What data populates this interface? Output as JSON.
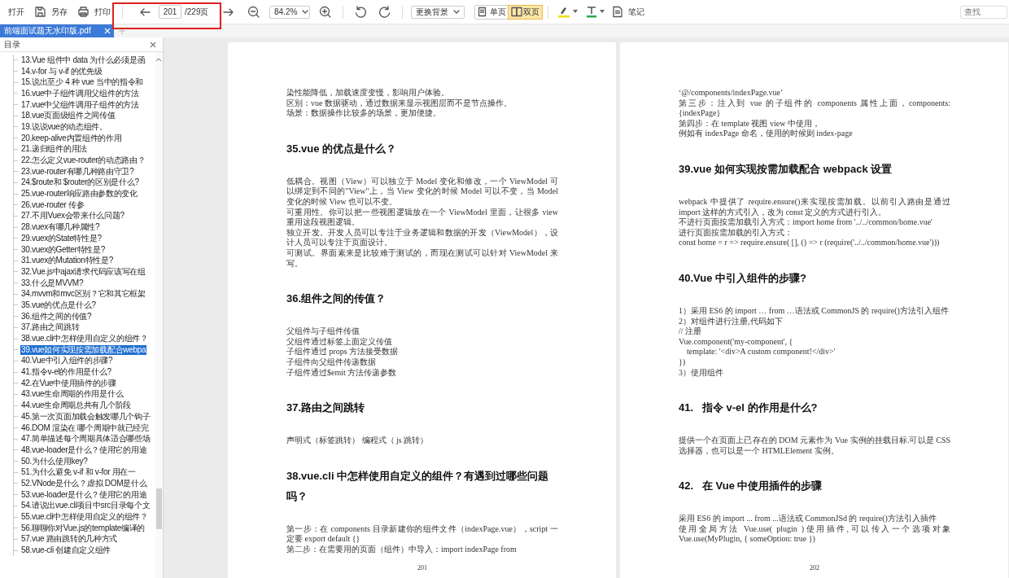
{
  "toolbar": {
    "file_actions": [
      "打开",
      "另存",
      "打印"
    ],
    "page_nav": {
      "current": "201",
      "total": "/229页"
    },
    "zoom": {
      "value": "84.2%"
    },
    "background_menu": {
      "label": "更换背景"
    },
    "view_modes": [
      {
        "label": "单页",
        "selected": false
      },
      {
        "label": "双页",
        "selected": true
      }
    ],
    "notes": {
      "label": "笔记"
    },
    "search": {
      "placeholder": "查找"
    }
  },
  "tabs": [
    {
      "label": "前端面试题无水印版.pdf",
      "selected": true
    }
  ],
  "sidebar": {
    "title": "目录",
    "items": [
      {
        "label": "13.Vue 组件中 data 为什么必须是函",
        "selected": false
      },
      {
        "label": "14.v-for 与 v-if 的优先级",
        "selected": false
      },
      {
        "label": "15.说出至少 4 种 vue 当中的指令和",
        "selected": false
      },
      {
        "label": "16.vue中子组件调用父组件的方法",
        "selected": false
      },
      {
        "label": "17.vue中父组件调用子组件的方法",
        "selected": false
      },
      {
        "label": "18.vue页面级组件之间传值",
        "selected": false
      },
      {
        "label": "19.说说vue的动态组件。",
        "selected": false
      },
      {
        "label": "20.keep-alive内置组件的作用",
        "selected": false
      },
      {
        "label": "21.递归组件的用法",
        "selected": false
      },
      {
        "label": "22.怎么定义vue-router的动态路由？",
        "selected": false
      },
      {
        "label": "23.vue-router有哪几种路由守卫?",
        "selected": false
      },
      {
        "label": "24.$route和 $router的区别是什么?",
        "selected": false
      },
      {
        "label": "25.vue-router响应路由参数的变化",
        "selected": false
      },
      {
        "label": "26.vue-router 传参",
        "selected": false
      },
      {
        "label": "27.不用Vuex会带来什么问题?",
        "selected": false
      },
      {
        "label": "28.vuex有哪几种属性?",
        "selected": false
      },
      {
        "label": "29.vuex的State特性是?",
        "selected": false
      },
      {
        "label": "30.vuex的Getter特性是?",
        "selected": false
      },
      {
        "label": "31.vuex的Mutation特性是?",
        "selected": false
      },
      {
        "label": "32.Vue.js中ajax请求代码应该写在组",
        "selected": false
      },
      {
        "label": "33.什么是MVVM?",
        "selected": false
      },
      {
        "label": "34.mvvm和mvc区别？它和其它框架",
        "selected": false
      },
      {
        "label": "35.vue的优点是什么?",
        "selected": false
      },
      {
        "label": "36.组件之间的传值?",
        "selected": false
      },
      {
        "label": "37.路由之间跳转",
        "selected": false
      },
      {
        "label": "38.vue.cli中怎样使用自定义的组件？",
        "selected": false
      },
      {
        "label": "39.vue如何实现按需加载配合webpa",
        "selected": true
      },
      {
        "label": "40.Vue中引入组件的步骤?",
        "selected": false
      },
      {
        "label": "41.指令v-el的作用是什么?",
        "selected": false
      },
      {
        "label": "42.在Vue中使用插件的步骤",
        "selected": false
      },
      {
        "label": "43.vue生命周期的作用是什么",
        "selected": false
      },
      {
        "label": "44.vue生命周期总共有几个阶段",
        "selected": false
      },
      {
        "label": "45.第一次页面加载会触发哪几个钩子",
        "selected": false
      },
      {
        "label": "46.DOM 渲染在 哪个周期中就已经完",
        "selected": false
      },
      {
        "label": "47.简单描述每个周期具体适合哪些场",
        "selected": false
      },
      {
        "label": "48.vue-loader是什么？使用它的用途",
        "selected": false
      },
      {
        "label": "50.为什么使用key?",
        "selected": false
      },
      {
        "label": "51.为什么避免 v-if 和 v-for 用在一",
        "selected": false
      },
      {
        "label": "52.VNode是什么？虚拟 DOM是什么",
        "selected": false
      },
      {
        "label": "53.vue-loader是什么？使用它的用途",
        "selected": false
      },
      {
        "label": "54.请说出vue.cli项目中src目录每个文",
        "selected": false
      },
      {
        "label": "55.vue.cli中怎样使用自定义的组件？",
        "selected": false
      },
      {
        "label": "56.聊聊你对Vue.js的template编译的",
        "selected": false
      },
      {
        "label": "57.vue 路由跳转的几种方式",
        "selected": false
      },
      {
        "label": "58.vue-cli 创建自定义组件",
        "selected": false
      }
    ]
  },
  "pages": [
    {
      "page_number": "201",
      "blocks": [
        {
          "kind": "para",
          "text": "染性能降低，加载速度变慢，影响用户体验。"
        },
        {
          "kind": "para",
          "text": "区别：vue 数据驱动，通过数据来显示视图层而不是节点操作。"
        },
        {
          "kind": "para",
          "text": "场景：数据操作比较多的场景，更加便捷。"
        },
        {
          "kind": "heading",
          "text": "35.vue 的优点是什么？"
        },
        {
          "kind": "para",
          "text": "低耦合。视图（View）可以独立于 Model 变化和修改，一个 ViewModel 可以绑定到不同的\"View\"上，当 View 变化的时候 Model 可以不变，当 Model 变化的时候 View 也可以不变。"
        },
        {
          "kind": "para",
          "text": "可重用性。你可以把一些视图逻辑放在一个 ViewModel 里面，让很多 view 重用这段视图逻辑。"
        },
        {
          "kind": "para",
          "text": "独立开发。开发人员可以专注于业务逻辑和数据的开发（ViewModel），设计人员可以专注于页面设计。"
        },
        {
          "kind": "para",
          "text": "可测试。界面素来是比较难于测试的，而现在测试可以针对 ViewModel 来写。"
        },
        {
          "kind": "heading",
          "text": "36.组件之间的传值？"
        },
        {
          "kind": "para",
          "text": "父组件与子组件传值"
        },
        {
          "kind": "para",
          "text": "父组件通过标签上面定义传值"
        },
        {
          "kind": "para",
          "text": "子组件通过 props 方法接受数据"
        },
        {
          "kind": "para",
          "text": "子组件向父组件传递数据"
        },
        {
          "kind": "para",
          "text": "子组件通过$emit 方法传递参数"
        },
        {
          "kind": "heading",
          "text": "37.路由之间跳转"
        },
        {
          "kind": "para",
          "text": "声明式（标签跳转） 编程式（ js 跳转）"
        },
        {
          "kind": "heading",
          "text": "38.vue.cli 中怎样使用自定义的组件？有遇到过哪些问题吗？"
        },
        {
          "kind": "para",
          "text": "第一步：在 components 目录新建你的组件文件（indexPage.vue），script 一定要 export default {}"
        },
        {
          "kind": "para",
          "text": "第二步：在需要用的页面（组件）中导入：import indexPage from"
        }
      ]
    },
    {
      "page_number": "202",
      "blocks": [
        {
          "kind": "para",
          "text": "‘@/components/indexPage.vue’"
        },
        {
          "kind": "para",
          "text": "第三步：注入到 vue 的子组件的 components 属性上面，components:{indexPage}"
        },
        {
          "kind": "para",
          "text": "第四步：在 template 视图 view 中使用，"
        },
        {
          "kind": "para",
          "text": "例如有 indexPage 命名，使用的时候则 index-page"
        },
        {
          "kind": "heading",
          "text": "39.vue 如何实现按需加载配合 webpack 设置"
        },
        {
          "kind": "para",
          "text": "webpack 中提供了 require.ensure()来实现按需加载。以前引入路由是通过 import 这样的方式引入，改为 const 定义的方式进行引入。"
        },
        {
          "kind": "para",
          "text": "不进行页面按需加载引入方式：import home from '../../common/home.vue'"
        },
        {
          "kind": "para",
          "text": "进行页面按需加载的引入方式："
        },
        {
          "kind": "para",
          "text": "const home = r => require.ensure( [], () => r (require('../../common/home.vue')))"
        },
        {
          "kind": "heading",
          "text": "40.Vue 中引入组件的步骤?"
        },
        {
          "kind": "para",
          "text": "1）采用 ES6 的 import … from …语法或 CommonJS 的 require()方法引入组件"
        },
        {
          "kind": "para",
          "text": "2）对组件进行注册,代码如下"
        },
        {
          "kind": "code",
          "text": "// 注册"
        },
        {
          "kind": "code",
          "text": "Vue.component('my-component', {"
        },
        {
          "kind": "code",
          "text": "    template: '<div>A custom component!</div>'"
        },
        {
          "kind": "code",
          "text": "})"
        },
        {
          "kind": "para",
          "text": "3）使用组件"
        },
        {
          "kind": "heading",
          "text": "41.   指令 v-el 的作用是什么?"
        },
        {
          "kind": "para",
          "text": "提供一个在页面上已存在的 DOM 元素作为 Vue 实例的挂载目标.可以是 CSS 选择器，也可以是一个 HTMLElement 实例。"
        },
        {
          "kind": "heading",
          "text": "42.   在 Vue 中使用插件的步骤"
        },
        {
          "kind": "para",
          "text": "采用 ES6 的 import ... from ...语法或 CommonJSd 的 require()方法引入插件"
        },
        {
          "kind": "para",
          "text": "使用全局方法 Vue.use( plugin )使用插件,可以传入一个选项对象 Vue.use(MyPlugin, { someOption: true })"
        }
      ]
    }
  ]
}
